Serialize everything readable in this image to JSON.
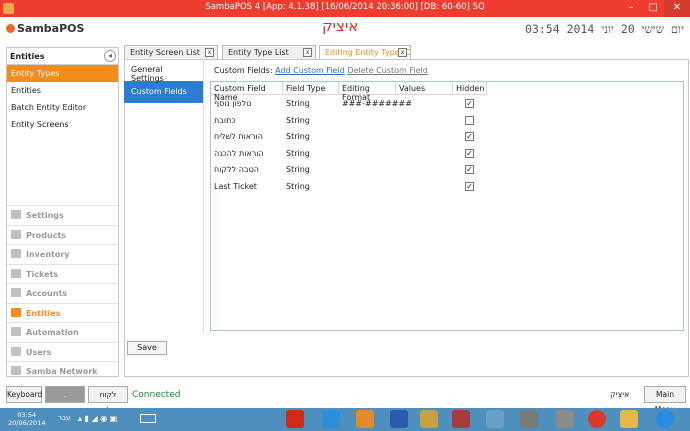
{
  "window": {
    "title": "SambaPOS 4 [App: 4.1.38] [16/06/2014 20:36:00] [DB: 60-60] SQ",
    "minimize": "–",
    "maximize": "□",
    "close": "✕"
  },
  "header": {
    "logo": "SambaPOS",
    "datetime": "03:54 2014 יום שישי 20 יוני",
    "big_title": "איציק"
  },
  "left_panel": {
    "heading": "Entities",
    "back": "◂",
    "items": [
      "Entity Types",
      "Entities",
      "Batch Entity Editor",
      "Entity Screens"
    ],
    "nav": [
      "Settings",
      "Products",
      "Inventory",
      "Tickets",
      "Accounts",
      "Entities",
      "Automation",
      "Users",
      "Samba Network"
    ]
  },
  "tabs": [
    {
      "label": "Entity Screen List",
      "close": "x"
    },
    {
      "label": "Entity Type List",
      "close": "x"
    },
    {
      "label": "Editing Entity Type (C(",
      "close": "x"
    }
  ],
  "subnav": [
    "General Settings",
    "Custom Fields"
  ],
  "custom_fields": {
    "label": "Custom Fields:",
    "add": "Add Custom Field",
    "delete": "Delete Custom Field",
    "columns": [
      "Custom Field Name",
      "Field Type",
      "Editing Format",
      "Values",
      "Hidden"
    ],
    "rows": [
      {
        "name": "טלפון נוסף",
        "type": "String",
        "format": "###-#######",
        "values": "",
        "hidden": true
      },
      {
        "name": "כתובת",
        "type": "String",
        "format": "",
        "values": "",
        "hidden": false
      },
      {
        "name": "הוראות לשליח",
        "type": "String",
        "format": "",
        "values": "",
        "hidden": true
      },
      {
        "name": "הוראות להכנה",
        "type": "String",
        "format": "",
        "values": "",
        "hidden": true
      },
      {
        "name": "הטבה ללקוח",
        "type": "String",
        "format": "",
        "values": "",
        "hidden": true
      },
      {
        "name": "Last Ticket",
        "type": "String",
        "format": "",
        "values": "",
        "hidden": true
      }
    ],
    "check_glyph": "✓"
  },
  "save_label": "Save",
  "status": {
    "keyboard": "Keyboard",
    "dot": ".",
    "customer": "לקוח בדלפק",
    "connected": "Connected",
    "user": "איציק",
    "main_menu": "Main Menu"
  },
  "taskbar": {
    "time": "03:54",
    "date": "20/06/2014",
    "lang": "עבר"
  },
  "colors": {
    "accent": "#f28c1e",
    "titlebar": "#ee3d2e",
    "selection": "#2a7dd1",
    "connected": "#1a8a2a"
  }
}
